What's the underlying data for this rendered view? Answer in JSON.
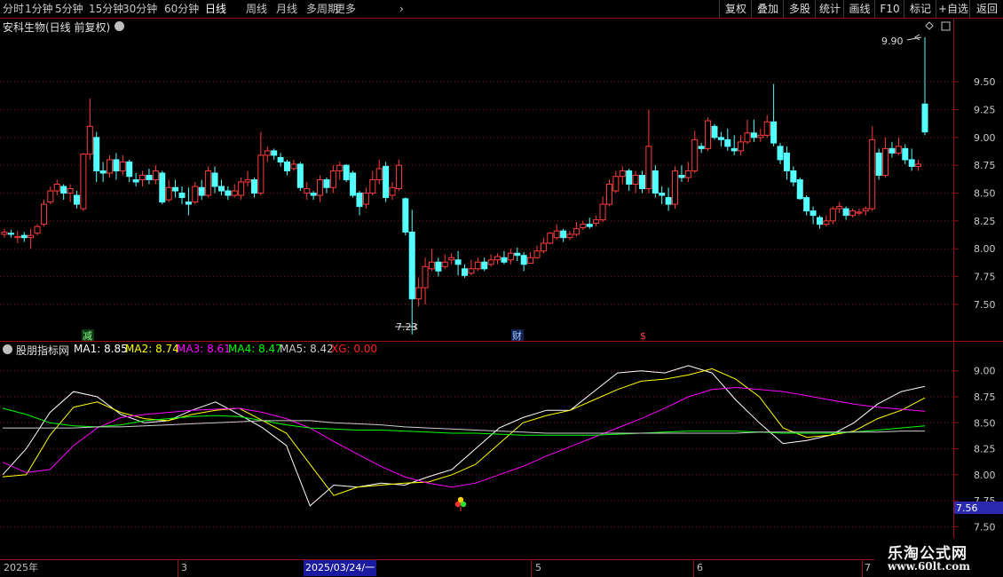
{
  "toolbar": {
    "periods": [
      "分时",
      "1分钟",
      "5分钟",
      "15分钟",
      "30分钟",
      "60分钟",
      "日线",
      "周线",
      "月线",
      "多周期",
      "更多"
    ],
    "active_period": "日线",
    "right_buttons": [
      "复权",
      "叠加",
      "多股",
      "统计",
      "画线",
      "F10",
      "标记",
      "+自选",
      "返回"
    ]
  },
  "main_panel": {
    "title": "安科生物(日线 前复权)",
    "high_label": "9.90",
    "low_label": "7.23",
    "y_ticks": [
      "9.50",
      "9.25",
      "9.00",
      "8.75",
      "8.50",
      "8.25",
      "8.00",
      "7.75",
      "7.50"
    ],
    "markers": {
      "jian": "减",
      "cai": "财",
      "dollar": "$"
    }
  },
  "sub_panel": {
    "title": "股朋指标网",
    "legend": [
      {
        "label": "MA1:",
        "value": "8.85",
        "color": "#ffffff"
      },
      {
        "label": "MA2:",
        "value": "8.74",
        "color": "#ffff00"
      },
      {
        "label": "MA3:",
        "value": "8.61",
        "color": "#ff00ff"
      },
      {
        "label": "MA4:",
        "value": "8.47",
        "color": "#00ff00"
      },
      {
        "label": "MA5:",
        "value": "8.42",
        "color": "#cccccc"
      },
      {
        "label": "XG:",
        "value": "0.00",
        "color": "#ff2020"
      }
    ],
    "y_ticks": [
      "9.00",
      "8.75",
      "8.50",
      "8.25",
      "8.00",
      "7.75",
      "7.50"
    ],
    "current_value": "7.56"
  },
  "timebar": {
    "labels": [
      "2025年",
      "3",
      "2025/03/24/一",
      "5",
      "6",
      "7"
    ]
  },
  "watermark": {
    "line1": "乐淘公式网",
    "line2": "www.60lt.com"
  },
  "colors": {
    "up": "#ff3c3c",
    "down": "#54ffff",
    "grid": "#8a1010",
    "highlight": "#2a2ab0"
  },
  "chart_data": {
    "type": "candlestick",
    "main_price_range": [
      7.3,
      9.9
    ],
    "candles": [
      [
        8.13,
        8.15,
        8.18,
        8.1
      ],
      [
        8.14,
        8.13,
        8.17,
        8.1
      ],
      [
        8.1,
        8.11,
        8.16,
        8.05
      ],
      [
        8.12,
        8.1,
        8.15,
        8.06
      ],
      [
        8.1,
        8.12,
        8.18,
        8.0
      ],
      [
        8.14,
        8.2,
        8.22,
        8.12
      ],
      [
        8.22,
        8.4,
        8.44,
        8.2
      ],
      [
        8.42,
        8.52,
        8.56,
        8.4
      ],
      [
        8.52,
        8.58,
        8.62,
        8.48
      ],
      [
        8.56,
        8.5,
        8.58,
        8.44
      ],
      [
        8.5,
        8.54,
        8.58,
        8.42
      ],
      [
        8.48,
        8.4,
        8.52,
        8.36
      ],
      [
        8.36,
        8.85,
        8.86,
        8.34
      ],
      [
        8.85,
        9.1,
        9.35,
        8.8
      ],
      [
        9.0,
        8.7,
        9.05,
        8.6
      ],
      [
        8.7,
        8.68,
        8.78,
        8.6
      ],
      [
        8.68,
        8.8,
        8.84,
        8.64
      ],
      [
        8.8,
        8.7,
        8.86,
        8.62
      ],
      [
        8.7,
        8.78,
        8.84,
        8.66
      ],
      [
        8.78,
        8.65,
        8.8,
        8.6
      ],
      [
        8.62,
        8.6,
        8.68,
        8.56
      ],
      [
        8.62,
        8.66,
        8.7,
        8.56
      ],
      [
        8.66,
        8.62,
        8.72,
        8.58
      ],
      [
        8.62,
        8.7,
        8.75,
        8.58
      ],
      [
        8.68,
        8.42,
        8.7,
        8.4
      ],
      [
        8.44,
        8.55,
        8.62,
        8.42
      ],
      [
        8.55,
        8.52,
        8.62,
        8.46
      ],
      [
        8.5,
        8.46,
        8.56,
        8.4
      ],
      [
        8.42,
        8.4,
        8.55,
        8.3
      ],
      [
        8.42,
        8.56,
        8.6,
        8.4
      ],
      [
        8.55,
        8.48,
        8.62,
        8.44
      ],
      [
        8.48,
        8.7,
        8.74,
        8.46
      ],
      [
        8.68,
        8.56,
        8.74,
        8.5
      ],
      [
        8.56,
        8.52,
        8.62,
        8.48
      ],
      [
        8.52,
        8.48,
        8.56,
        8.44
      ],
      [
        8.48,
        8.52,
        8.58,
        8.46
      ],
      [
        8.48,
        8.6,
        8.64,
        8.44
      ],
      [
        8.6,
        8.62,
        8.7,
        8.56
      ],
      [
        8.62,
        8.5,
        8.64,
        8.46
      ],
      [
        8.5,
        8.84,
        9.05,
        8.48
      ],
      [
        8.84,
        8.88,
        8.92,
        8.78
      ],
      [
        8.88,
        8.84,
        8.9,
        8.8
      ],
      [
        8.82,
        8.78,
        8.86,
        8.74
      ],
      [
        8.78,
        8.7,
        8.8,
        8.66
      ],
      [
        8.72,
        8.76,
        8.8,
        8.7
      ],
      [
        8.76,
        8.55,
        8.78,
        8.52
      ],
      [
        8.5,
        8.54,
        8.6,
        8.44
      ],
      [
        8.5,
        8.48,
        8.52,
        8.44
      ],
      [
        8.48,
        8.62,
        8.66,
        8.42
      ],
      [
        8.62,
        8.55,
        8.64,
        8.5
      ],
      [
        8.55,
        8.7,
        8.75,
        8.5
      ],
      [
        8.7,
        8.75,
        8.78,
        8.62
      ],
      [
        8.75,
        8.62,
        8.76,
        8.6
      ],
      [
        8.68,
        8.48,
        8.7,
        8.46
      ],
      [
        8.5,
        8.38,
        8.52,
        8.3
      ],
      [
        8.4,
        8.5,
        8.55,
        8.36
      ],
      [
        8.5,
        8.62,
        8.7,
        8.48
      ],
      [
        8.62,
        8.72,
        8.8,
        8.58
      ],
      [
        8.74,
        8.46,
        8.78,
        8.42
      ],
      [
        8.48,
        8.55,
        8.6,
        8.44
      ],
      [
        8.54,
        8.75,
        8.8,
        8.52
      ],
      [
        8.45,
        8.15,
        8.46,
        8.12
      ],
      [
        8.15,
        7.55,
        8.35,
        7.23
      ],
      [
        7.55,
        7.65,
        7.74,
        7.48
      ],
      [
        7.65,
        7.84,
        7.92,
        7.5
      ],
      [
        7.82,
        7.88,
        8.0,
        7.8
      ],
      [
        7.88,
        7.8,
        7.92,
        7.75
      ],
      [
        7.84,
        7.88,
        7.95,
        7.82
      ],
      [
        7.9,
        7.92,
        7.96,
        7.86
      ],
      [
        7.9,
        7.86,
        7.98,
        7.76
      ],
      [
        7.82,
        7.76,
        7.86,
        7.74
      ],
      [
        7.78,
        7.82,
        7.9,
        7.76
      ],
      [
        7.82,
        7.88,
        7.92,
        7.8
      ],
      [
        7.88,
        7.82,
        7.92,
        7.8
      ],
      [
        7.86,
        7.9,
        7.95,
        7.84
      ],
      [
        7.9,
        7.93,
        7.96,
        7.86
      ],
      [
        7.92,
        7.88,
        7.98,
        7.86
      ],
      [
        7.9,
        7.96,
        8.0,
        7.86
      ],
      [
        7.96,
        7.94,
        8.01,
        7.89
      ],
      [
        7.94,
        7.86,
        7.97,
        7.8
      ],
      [
        7.87,
        7.92,
        7.97,
        7.87
      ],
      [
        7.92,
        7.98,
        8.03,
        7.91
      ],
      [
        7.98,
        8.05,
        8.1,
        7.96
      ],
      [
        8.05,
        8.14,
        8.15,
        8.04
      ],
      [
        8.1,
        8.16,
        8.22,
        8.08
      ],
      [
        8.16,
        8.1,
        8.18,
        8.06
      ],
      [
        8.1,
        8.13,
        8.16,
        8.08
      ],
      [
        8.13,
        8.18,
        8.24,
        8.11
      ],
      [
        8.19,
        8.22,
        8.25,
        8.17
      ],
      [
        8.22,
        8.2,
        8.28,
        8.18
      ],
      [
        8.23,
        8.26,
        8.3,
        8.2
      ],
      [
        8.26,
        8.4,
        8.47,
        8.24
      ],
      [
        8.4,
        8.58,
        8.62,
        8.38
      ],
      [
        8.52,
        8.65,
        8.7,
        8.5
      ],
      [
        8.65,
        8.7,
        8.74,
        8.58
      ],
      [
        8.7,
        8.58,
        8.72,
        8.52
      ],
      [
        8.58,
        8.66,
        8.7,
        8.5
      ],
      [
        8.66,
        8.54,
        8.7,
        8.5
      ],
      [
        8.54,
        8.92,
        9.25,
        8.5
      ],
      [
        8.7,
        8.5,
        8.75,
        8.46
      ],
      [
        8.5,
        8.48,
        8.56,
        8.4
      ],
      [
        8.46,
        8.4,
        8.55,
        8.34
      ],
      [
        8.4,
        8.7,
        8.74,
        8.36
      ],
      [
        8.66,
        8.64,
        8.75,
        8.6
      ],
      [
        8.64,
        8.7,
        8.78,
        8.6
      ],
      [
        8.7,
        8.98,
        9.06,
        8.68
      ],
      [
        8.92,
        8.9,
        8.95,
        8.86
      ],
      [
        8.9,
        9.15,
        9.18,
        8.88
      ],
      [
        9.1,
        9.0,
        9.12,
        8.98
      ],
      [
        9.0,
        8.98,
        9.05,
        8.92
      ],
      [
        8.98,
        8.92,
        9.08,
        8.88
      ],
      [
        8.9,
        8.88,
        9.02,
        8.84
      ],
      [
        8.88,
        8.96,
        9.02,
        8.84
      ],
      [
        8.96,
        9.04,
        9.16,
        8.94
      ],
      [
        9.04,
        9.0,
        9.16,
        8.96
      ],
      [
        9.0,
        9.02,
        9.08,
        8.96
      ],
      [
        9.02,
        9.14,
        9.2,
        9.0
      ],
      [
        9.14,
        8.95,
        9.48,
        8.92
      ],
      [
        8.92,
        8.8,
        8.95,
        8.76
      ],
      [
        8.86,
        8.7,
        8.92,
        8.62
      ],
      [
        8.7,
        8.6,
        8.74,
        8.56
      ],
      [
        8.62,
        8.45,
        8.64,
        8.44
      ],
      [
        8.46,
        8.34,
        8.48,
        8.3
      ],
      [
        8.34,
        8.3,
        8.38,
        8.22
      ],
      [
        8.28,
        8.22,
        8.3,
        8.18
      ],
      [
        8.22,
        8.25,
        8.3,
        8.2
      ],
      [
        8.25,
        8.36,
        8.38,
        8.22
      ],
      [
        8.36,
        8.38,
        8.42,
        8.32
      ],
      [
        8.36,
        8.3,
        8.38,
        8.26
      ],
      [
        8.3,
        8.34,
        8.36,
        8.28
      ],
      [
        8.32,
        8.33,
        8.36,
        8.3
      ],
      [
        8.34,
        8.36,
        8.38,
        8.3
      ],
      [
        8.36,
        8.98,
        9.1,
        8.34
      ],
      [
        8.86,
        8.66,
        8.9,
        8.62
      ],
      [
        8.66,
        8.9,
        9.0,
        8.64
      ],
      [
        8.9,
        8.86,
        8.96,
        8.82
      ],
      [
        8.86,
        8.92,
        9.0,
        8.84
      ],
      [
        8.9,
        8.8,
        8.94,
        8.76
      ],
      [
        8.8,
        8.74,
        8.9,
        8.7
      ],
      [
        8.74,
        8.76,
        8.8,
        8.7
      ],
      [
        9.3,
        9.05,
        9.9,
        9.02
      ]
    ],
    "sub_price_range": [
      7.46,
      9.16
    ],
    "series": [
      {
        "name": "MA1",
        "color": "#ffffff",
        "values": [
          8.0,
          8.25,
          8.6,
          8.8,
          8.75,
          8.58,
          8.5,
          8.52,
          8.62,
          8.7,
          8.58,
          8.45,
          8.28,
          7.7,
          7.9,
          7.88,
          7.92,
          7.9,
          7.98,
          8.05,
          8.25,
          8.45,
          8.55,
          8.62,
          8.62,
          8.8,
          8.98,
          9.0,
          8.98,
          9.05,
          8.98,
          8.72,
          8.5,
          8.3,
          8.33,
          8.38,
          8.5,
          8.68,
          8.8,
          8.85
        ]
      },
      {
        "name": "MA2",
        "color": "#ffff00",
        "values": [
          7.98,
          8.0,
          8.38,
          8.65,
          8.7,
          8.6,
          8.54,
          8.52,
          8.58,
          8.62,
          8.64,
          8.52,
          8.4,
          8.1,
          7.8,
          7.88,
          7.9,
          7.92,
          7.93,
          8.0,
          8.1,
          8.3,
          8.5,
          8.57,
          8.62,
          8.72,
          8.82,
          8.9,
          8.92,
          8.96,
          9.02,
          8.92,
          8.75,
          8.45,
          8.36,
          8.38,
          8.42,
          8.54,
          8.62,
          8.74
        ]
      },
      {
        "name": "MA3",
        "color": "#ff00ff",
        "values": [
          8.12,
          8.02,
          8.05,
          8.28,
          8.45,
          8.55,
          8.58,
          8.6,
          8.62,
          8.63,
          8.64,
          8.6,
          8.54,
          8.45,
          8.32,
          8.2,
          8.08,
          7.98,
          7.92,
          7.88,
          7.92,
          8.0,
          8.08,
          8.18,
          8.27,
          8.36,
          8.45,
          8.54,
          8.64,
          8.75,
          8.82,
          8.84,
          8.82,
          8.8,
          8.76,
          8.72,
          8.68,
          8.65,
          8.63,
          8.61
        ]
      },
      {
        "name": "MA4",
        "color": "#00ff00",
        "values": [
          8.64,
          8.58,
          8.5,
          8.47,
          8.46,
          8.48,
          8.52,
          8.54,
          8.56,
          8.57,
          8.56,
          8.52,
          8.48,
          8.45,
          8.44,
          8.43,
          8.43,
          8.42,
          8.41,
          8.4,
          8.4,
          8.39,
          8.38,
          8.38,
          8.38,
          8.38,
          8.39,
          8.4,
          8.41,
          8.42,
          8.42,
          8.42,
          8.41,
          8.4,
          8.4,
          8.4,
          8.41,
          8.43,
          8.45,
          8.47
        ]
      },
      {
        "name": "MA5",
        "color": "#cccccc",
        "values": [
          8.45,
          8.45,
          8.45,
          8.45,
          8.46,
          8.46,
          8.47,
          8.48,
          8.49,
          8.5,
          8.51,
          8.52,
          8.52,
          8.52,
          8.5,
          8.49,
          8.48,
          8.46,
          8.45,
          8.44,
          8.43,
          8.42,
          8.41,
          8.4,
          8.4,
          8.4,
          8.4,
          8.4,
          8.4,
          8.4,
          8.4,
          8.4,
          8.41,
          8.41,
          8.41,
          8.41,
          8.41,
          8.41,
          8.42,
          8.42
        ]
      }
    ]
  }
}
